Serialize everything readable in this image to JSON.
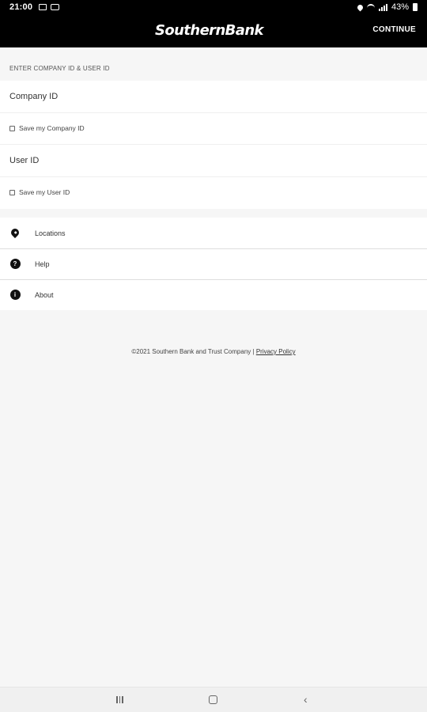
{
  "status_bar": {
    "time": "21:00",
    "battery_text": "43%"
  },
  "header": {
    "logo_text": "SouthernBank",
    "continue_label": "CONTINUE"
  },
  "form": {
    "section_label": "ENTER COMPANY ID & USER ID",
    "company_id_placeholder": "Company ID",
    "save_company_id_label": "Save my Company ID",
    "user_id_placeholder": "User ID",
    "save_user_id_label": "Save my User ID"
  },
  "menu": {
    "items": [
      {
        "label": "Locations",
        "icon": "location-pin-icon"
      },
      {
        "label": "Help",
        "icon": "help-icon"
      },
      {
        "label": "About",
        "icon": "info-icon"
      }
    ]
  },
  "footer": {
    "copyright": "©2021 Southern Bank and Trust Company |",
    "privacy_link": "Privacy Policy"
  },
  "colors": {
    "header_bg": "#000000",
    "page_bg": "#f6f6f6",
    "card_bg": "#ffffff"
  }
}
